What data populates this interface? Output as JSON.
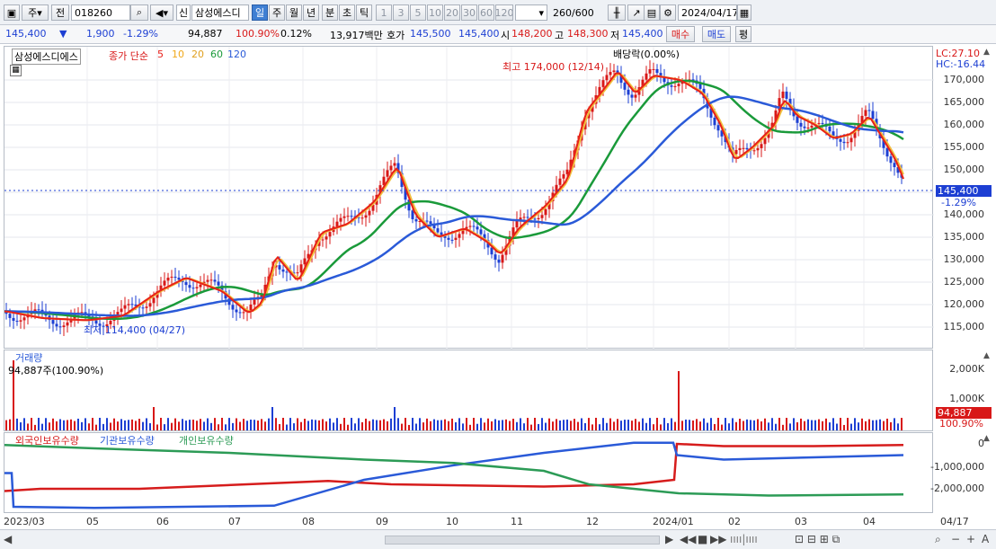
{
  "toolbar": {
    "mode_btn": "주",
    "prev_btn": "전",
    "code": "018260",
    "stock_name": "삼성에스디",
    "credit_badge": "신",
    "periods": [
      "일",
      "주",
      "월",
      "년",
      "분",
      "초",
      "틱"
    ],
    "minutes": [
      "1",
      "3",
      "5",
      "10",
      "20",
      "30",
      "60",
      "120"
    ],
    "count": "260/600",
    "date": "2024/04/17"
  },
  "quote": {
    "price": "145,400",
    "change": "1,900",
    "change_pct": "-1.29%",
    "volume": "94,887",
    "volume_ratio": "100.90%",
    "turnover": "0.12%",
    "amount": "13,917백만",
    "ask_label": "호가",
    "ask": "145,500",
    "bid": "145,400",
    "open_label": "시",
    "open": "148,200",
    "high_label": "고",
    "high": "148,300",
    "low_label": "저",
    "low": "145,400",
    "buy_btn": "매수",
    "sell_btn": "매도",
    "eval_btn": "평"
  },
  "price_panel": {
    "name": "삼성에스디에스",
    "legend_label": "종가 단순",
    "ma": [
      {
        "period": "5",
        "color": "#e8201a"
      },
      {
        "period": "10",
        "color": "#f0a81a"
      },
      {
        "period": "20",
        "color": "#e0a020"
      },
      {
        "period": "60",
        "color": "#1a9a3a"
      },
      {
        "period": "120",
        "color": "#2a5ad8"
      }
    ],
    "lc": "LC:27.10",
    "hc": "HC:-16.44",
    "max_label": "최고 174,000 (12/14)",
    "min_label": "최저 114,400 (04/27)",
    "dividend_label": "배당락(0.00%)",
    "current_tag": "145,400",
    "current_pct": "-1.29%",
    "y_ticks": [
      "170,000",
      "165,000",
      "160,000",
      "155,000",
      "150,000",
      "145,000",
      "140,000",
      "135,000",
      "130,000",
      "125,000",
      "120,000",
      "115,000"
    ]
  },
  "volume_panel": {
    "title": "거래량",
    "last_label": "94,887주(100.90%)",
    "tag": "94,887",
    "tag_pct": "100.90%",
    "y_ticks": [
      "2,000K",
      "1,000K"
    ]
  },
  "holding_panel": {
    "legend": [
      {
        "label": "외국인보유수량",
        "color": "#d61c1c"
      },
      {
        "label": "기관보유수량",
        "color": "#2a5ad8"
      },
      {
        "label": "개인보유수량",
        "color": "#2c9b56"
      }
    ],
    "y_ticks": [
      "0",
      "-1,000,000",
      "-2,000,000"
    ]
  },
  "x_labels": [
    "2023/03",
    "05",
    "06",
    "07",
    "08",
    "09",
    "10",
    "11",
    "12",
    "2024/01",
    "02",
    "03",
    "04",
    "04/17"
  ],
  "colors": {
    "up": "#d81818",
    "down": "#1d3fd3",
    "accent": "#3f7fd3"
  }
}
